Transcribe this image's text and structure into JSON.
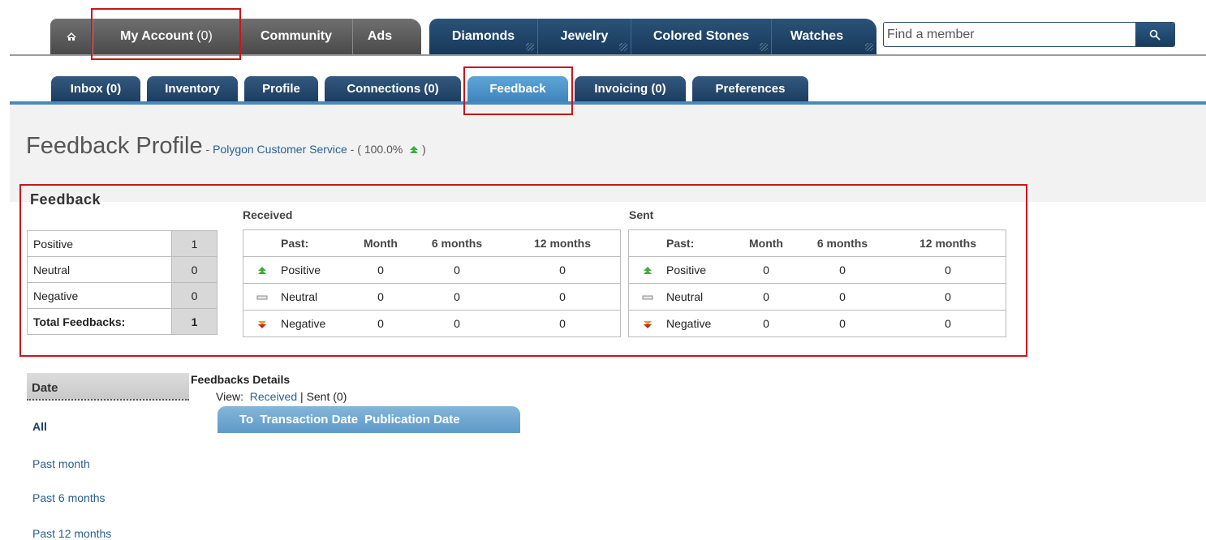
{
  "topnav": {
    "home_icon": "home-icon",
    "my_account": "My Account",
    "my_account_count": "(0)",
    "community": "Community",
    "ads": "Ads",
    "diamonds": "Diamonds",
    "jewelry": "Jewelry",
    "colored_stones": "Colored Stones",
    "watches": "Watches",
    "search_placeholder": "Find a member",
    "search_icon": "magnifier-icon"
  },
  "subnav": {
    "tabs": [
      {
        "label": "Inbox (0)"
      },
      {
        "label": "Inventory"
      },
      {
        "label": "Profile"
      },
      {
        "label": "Connections (0)"
      },
      {
        "label": "Feedback",
        "active": true
      },
      {
        "label": "Invoicing (0)"
      },
      {
        "label": "Preferences"
      }
    ]
  },
  "page": {
    "title": "Feedback Profile",
    "dash1": " - ",
    "member_name": "Polygon Customer Service",
    "dash2": " - ( ",
    "percentage": "100.0%",
    "close_paren": " )"
  },
  "feedback": {
    "title": "Feedback",
    "summary": {
      "rows": [
        {
          "label": "Positive",
          "value": "1"
        },
        {
          "label": "Neutral",
          "value": "0"
        },
        {
          "label": "Negative",
          "value": "0"
        },
        {
          "label": "Total Feedbacks:",
          "value": "1"
        }
      ]
    },
    "received": {
      "label": "Received",
      "headers": {
        "past": "Past:",
        "month": "Month",
        "six": "6 months",
        "twelve": "12 months"
      },
      "rows": [
        {
          "label": "Positive",
          "month": "0",
          "six": "0",
          "twelve": "0",
          "icon": "green-up-arrow-icon"
        },
        {
          "label": "Neutral",
          "month": "0",
          "six": "0",
          "twelve": "0",
          "icon": "neutral-dash-icon"
        },
        {
          "label": "Negative",
          "month": "0",
          "six": "0",
          "twelve": "0",
          "icon": "red-down-arrow-icon"
        }
      ]
    },
    "sent": {
      "label": "Sent",
      "headers": {
        "past": "Past:",
        "month": "Month",
        "six": "6 months",
        "twelve": "12 months"
      },
      "rows": [
        {
          "label": "Positive",
          "month": "0",
          "six": "0",
          "twelve": "0",
          "icon": "green-up-arrow-icon"
        },
        {
          "label": "Neutral",
          "month": "0",
          "six": "0",
          "twelve": "0",
          "icon": "neutral-dash-icon"
        },
        {
          "label": "Negative",
          "month": "0",
          "six": "0",
          "twelve": "0",
          "icon": "red-down-arrow-icon"
        }
      ]
    }
  },
  "date_filter": {
    "heading": "Date",
    "items": [
      "All",
      "Past month",
      "Past 6 months",
      "Past 12 months"
    ]
  },
  "details": {
    "title": "Feedbacks Details",
    "view_label": "View:",
    "received_link": "Received",
    "separator": " | ",
    "sent_label": "Sent (0)",
    "columns": [
      "To",
      "Transaction Date",
      "Publication Date"
    ]
  },
  "colors": {
    "accent_blue": "#4a88bf",
    "nav_dark": "#4a4a4a",
    "nav_blue": "#17385a",
    "highlight_red": "#c8161d",
    "positive_green": "#3cae3c",
    "negative_red": "#d02020"
  }
}
